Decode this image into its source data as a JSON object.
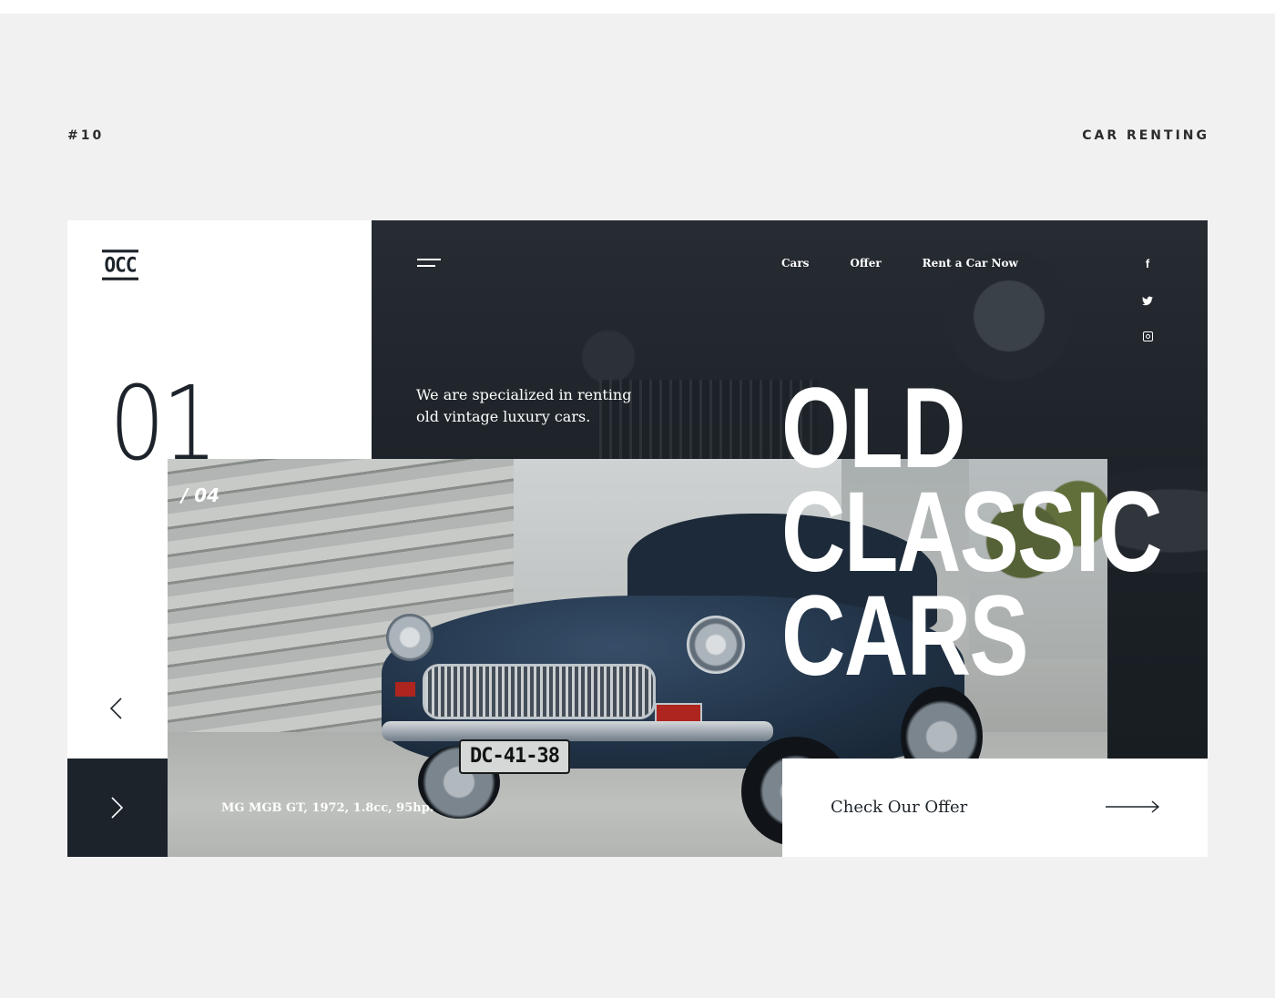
{
  "meta": {
    "number": "#10",
    "category": "CAR RENTING"
  },
  "brand": {
    "logo": "OCC"
  },
  "nav": {
    "items": [
      "Cars",
      "Offer",
      "Rent a Car Now"
    ]
  },
  "social": {
    "facebook": "f",
    "twitter": "twitter-icon",
    "instagram": "instagram-icon"
  },
  "hero": {
    "tagline": "We are specialized in renting old vintage luxury cars.",
    "headline": [
      "OLD",
      "CLASSIC",
      "CARS"
    ],
    "slide_current": "01",
    "slide_total": "/ 04",
    "caption": "MG MGB GT, 1972, 1.8cc, 95hp.",
    "plate": "DC-41-38"
  },
  "cta": {
    "label": "Check Our Offer"
  },
  "colors": {
    "background": "#f1f1f1",
    "dark": "#1d232a",
    "white": "#ffffff"
  }
}
